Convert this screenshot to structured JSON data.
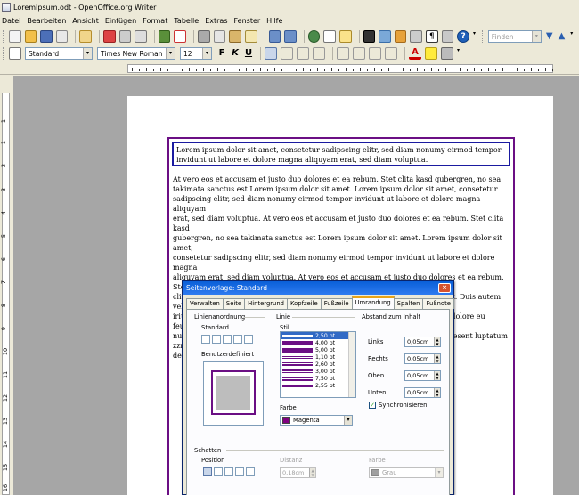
{
  "window": {
    "title": "LoremIpsum.odt - OpenOffice.org Writer"
  },
  "menu": [
    "Datei",
    "Bearbeiten",
    "Ansicht",
    "Einfügen",
    "Format",
    "Tabelle",
    "Extras",
    "Fenster",
    "Hilfe"
  ],
  "toolbar": {
    "find_placeholder": "Finden",
    "style": "Standard",
    "font": "Times New Roman",
    "size": "12",
    "bold": "F",
    "italic": "K",
    "underline": "U"
  },
  "ruler": {
    "v_numbers": [
      "1",
      "1",
      "2",
      "3",
      "4",
      "5",
      "6",
      "7",
      "8",
      "9",
      "10",
      "11",
      "12",
      "13",
      "14",
      "15",
      "16"
    ]
  },
  "document": {
    "header_text": "Lorem ipsum dolor sit amet, consetetur sadipscing elitr, sed diam nonumy eirmod tempor invidunt ut labore et dolore magna aliquyam erat, sed diam voluptua.",
    "body_lines": [
      " At vero eos et accusam et justo duo dolores et ea rebum. Stet clita kasd gubergren, no sea",
      "takimata sanctus est Lorem ipsum dolor sit amet. Lorem ipsum dolor sit amet, consetetur",
      "sadipscing elitr, sed diam nonumy eirmod tempor invidunt ut labore et dolore magna aliquyam",
      "erat, sed diam voluptua. At vero eos et accusam et justo duo dolores et ea rebum. Stet clita kasd",
      "gubergren, no sea takimata sanctus est Lorem ipsum dolor sit amet. Lorem ipsum dolor sit amet,",
      "consetetur sadipscing elitr, sed diam nonumy eirmod tempor invidunt ut labore et dolore magna",
      "aliquyam erat, sed diam voluptua. At vero eos et accusam et justo duo dolores et ea rebum. Stet",
      "clita kasd gubergren, no sea takimata sanctus est Lorem ipsum dolor sit amet. Duis autem vel eum",
      "iriure dolor in hendrerit in vulputate velit esse molestie consequat, vel illum dolore eu feugiat",
      "nulla facilisis at vero eros et accumsan et iusto odio dignissim qui blandit praesent luptatum zzril",
      "delenit augue duis dolore te feugait nulla facilisi. Lorem ipsum dolor sit amet"
    ]
  },
  "dialog": {
    "title": "Seitenvorlage: Standard",
    "close": "×",
    "tabs": [
      "Verwalten",
      "Seite",
      "Hintergrund",
      "Kopfzeile",
      "Fußzeile",
      "Umrandung",
      "Spalten",
      "Fußnote"
    ],
    "active_tab": "Umrandung",
    "linienanordnung": {
      "heading": "Linienanordnung",
      "standard": "Standard",
      "benutzer": "Benutzerdefiniert"
    },
    "linie": {
      "heading": "Linie",
      "stil": "Stil",
      "styles": [
        "2,50 pt",
        "4,00 pt",
        "5,00 pt",
        "1,10 pt",
        "2,60 pt",
        "3,00 pt",
        "7,50 pt",
        "2,55 pt"
      ],
      "selected_index": 0,
      "farbe": "Farbe",
      "farbe_value": "Magenta",
      "farbe_color": "#800080"
    },
    "abstand": {
      "heading": "Abstand zum Inhalt",
      "rows": [
        {
          "label": "Links",
          "value": "0,05cm"
        },
        {
          "label": "Rechts",
          "value": "0,05cm"
        },
        {
          "label": "Oben",
          "value": "0,05cm"
        },
        {
          "label": "Unten",
          "value": "0,05cm"
        }
      ],
      "sync": "Synchronisieren"
    },
    "schatten": {
      "heading": "Schatten",
      "position": "Position",
      "distanz": "Distanz",
      "distanz_value": "0,18cm",
      "farbe": "Farbe",
      "farbe_value": "Grau"
    }
  }
}
